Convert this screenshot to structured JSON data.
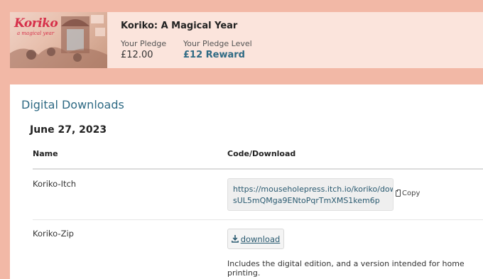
{
  "pledge": {
    "cover_logo": "Koriko",
    "cover_subtitle": "a magical year",
    "title": "Koriko: A Magical Year",
    "your_pledge_label": "Your Pledge",
    "your_pledge_value": "£12.00",
    "pledge_level_label": "Your Pledge Level",
    "pledge_level_value": "£12 Reward"
  },
  "downloads": {
    "section_title": "Digital Downloads",
    "date": "June 27, 2023",
    "columns": [
      "Name",
      "Code/Download"
    ],
    "rows": [
      {
        "name": "Koriko-Itch",
        "code_line1": "https://mouseholepress.itch.io/koriko/download/",
        "code_line2": "sUL5mQMga9ENtoPqrTmXMS1kem6p",
        "copy_label": "Copy"
      },
      {
        "name": "Koriko-Zip",
        "download_label": "download",
        "description": "Includes the digital edition, and a version intended for home printing."
      }
    ]
  },
  "colors": {
    "background": "#f2b8a6",
    "header_band": "#fbe4dc",
    "accent": "#2e6a84",
    "logo": "#d6304a"
  }
}
